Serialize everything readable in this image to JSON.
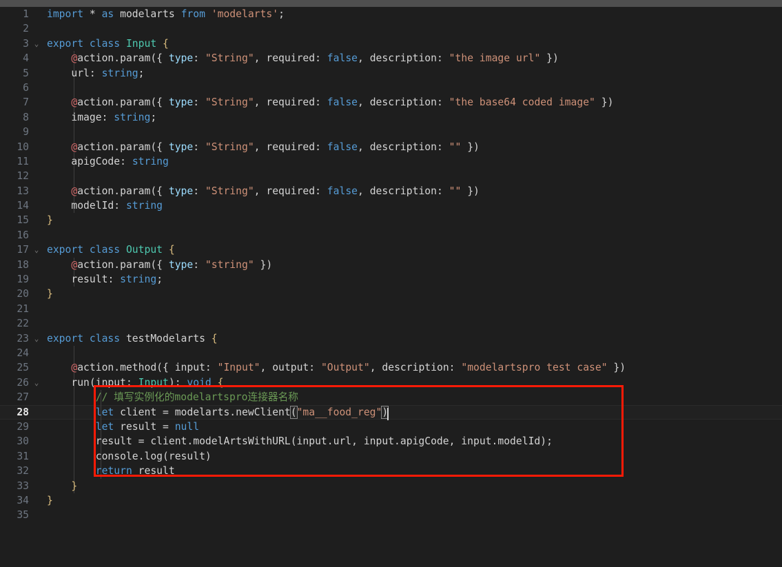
{
  "editor": {
    "title": "code-editor",
    "theme": "dark-plus",
    "background": "#1e1e1e",
    "current_line": 28,
    "cursor_column": 73,
    "total_lines": 35,
    "scrollbar": {
      "orientation": "horizontal",
      "position": "top"
    },
    "annotation": {
      "type": "rectangle",
      "color": "#ff1a06",
      "covers_lines": "27-32"
    },
    "colors": {
      "keyword": "#569cd6",
      "string": "#ce9178",
      "class": "#4ec9b0",
      "comment": "#6a9955",
      "decorator": "#d16969",
      "property": "#9cdcfe",
      "plain": "#d4d4d4",
      "bracket": "#d7ba7d",
      "line_number": "#6e7681",
      "line_number_active": "#e7e7e7"
    }
  },
  "lines": [
    {
      "n": "1",
      "fold": "",
      "guides": 0
    },
    {
      "n": "2",
      "fold": "",
      "guides": 0
    },
    {
      "n": "3",
      "fold": "⌄",
      "guides": 0
    },
    {
      "n": "4",
      "fold": "",
      "guides": 1
    },
    {
      "n": "5",
      "fold": "",
      "guides": 1
    },
    {
      "n": "6",
      "fold": "",
      "guides": 1
    },
    {
      "n": "7",
      "fold": "",
      "guides": 1
    },
    {
      "n": "8",
      "fold": "",
      "guides": 1
    },
    {
      "n": "9",
      "fold": "",
      "guides": 1
    },
    {
      "n": "10",
      "fold": "",
      "guides": 1
    },
    {
      "n": "11",
      "fold": "",
      "guides": 1
    },
    {
      "n": "12",
      "fold": "",
      "guides": 1
    },
    {
      "n": "13",
      "fold": "",
      "guides": 1
    },
    {
      "n": "14",
      "fold": "",
      "guides": 1
    },
    {
      "n": "15",
      "fold": "",
      "guides": 0
    },
    {
      "n": "16",
      "fold": "",
      "guides": 0
    },
    {
      "n": "17",
      "fold": "⌄",
      "guides": 0
    },
    {
      "n": "18",
      "fold": "",
      "guides": 1
    },
    {
      "n": "19",
      "fold": "",
      "guides": 1
    },
    {
      "n": "20",
      "fold": "",
      "guides": 0
    },
    {
      "n": "21",
      "fold": "",
      "guides": 0
    },
    {
      "n": "22",
      "fold": "",
      "guides": 0
    },
    {
      "n": "23",
      "fold": "⌄",
      "guides": 0
    },
    {
      "n": "24",
      "fold": "",
      "guides": 1
    },
    {
      "n": "25",
      "fold": "",
      "guides": 1
    },
    {
      "n": "26",
      "fold": "⌄",
      "guides": 1
    },
    {
      "n": "27",
      "fold": "",
      "guides": 2
    },
    {
      "n": "28",
      "fold": "",
      "guides": 2
    },
    {
      "n": "29",
      "fold": "",
      "guides": 2
    },
    {
      "n": "30",
      "fold": "",
      "guides": 2
    },
    {
      "n": "31",
      "fold": "",
      "guides": 2
    },
    {
      "n": "32",
      "fold": "",
      "guides": 2
    },
    {
      "n": "33",
      "fold": "",
      "guides": 1
    },
    {
      "n": "34",
      "fold": "",
      "guides": 0
    },
    {
      "n": "35",
      "fold": "",
      "guides": 0
    }
  ],
  "code": {
    "l1": "import * as modelarts from 'modelarts';",
    "l2": "",
    "l3": "export class Input {",
    "l4": "    @action.param({ type: \"String\", required: false, description: \"the image url\" })",
    "l5": "    url: string;",
    "l6": "",
    "l7": "    @action.param({ type: \"String\", required: false, description: \"the base64 coded image\" })",
    "l8": "    image: string;",
    "l9": "",
    "l10": "    @action.param({ type: \"String\", required: false, description: \"\" })",
    "l11": "    apigCode: string",
    "l12": "",
    "l13": "    @action.param({ type: \"String\", required: false, description: \"\" })",
    "l14": "    modelId: string",
    "l15": "}",
    "l16": "",
    "l17": "export class Output {",
    "l18": "    @action.param({ type: \"string\" })",
    "l19": "    result: string;",
    "l20": "}",
    "l21": "",
    "l22": "",
    "l23": "export class testModelarts {",
    "l24": "",
    "l25": "    @action.method({ input: \"Input\", output: \"Output\", description: \"modelartspro test case\" })",
    "l26": "    run(input: Input): void {",
    "l27": "        // 填写实例化的modelartspro连接器名称",
    "l28": "        let client = modelarts.newClient(\"ma__food_reg\")",
    "l29": "        let result = null",
    "l30": "        result = client.modelArtsWithURL(input.url, input.apigCode, input.modelId);",
    "l31": "        console.log(result)",
    "l32": "        return result",
    "l33": "    }",
    "l34": "}",
    "l35": ""
  },
  "tokens": {
    "kw_import": "import",
    "star": " * ",
    "kw_as": "as",
    "id_modelarts": " modelarts ",
    "kw_from": "from",
    "str_modelarts": " 'modelarts'",
    "semi": ";",
    "kw_export": "export",
    "kw_class": "class",
    "cls_Input": "Input",
    "cls_Output": "Output",
    "id_testModelarts": "testModelarts",
    "brace_open": "{",
    "brace_close": "}",
    "at": "@",
    "action_param": "action.param({ ",
    "action_method": "action.method({ ",
    "prop_type": "type",
    "prop_input": "input",
    "prop_output": "output",
    "prop_required": "required",
    "prop_description": "description",
    "colon": ": ",
    "comma": ", ",
    "str_String": "\"String\"",
    "str_string_lc": "\"string\"",
    "kw_false": "false",
    "str_the_image_url": "\"the image url\"",
    "str_the_base64": "\"the base64 coded image\"",
    "str_empty": "\"\"",
    "str_Input": "\"Input\"",
    "str_Output": "\"Output\"",
    "str_modelartspro_test_case": "\"modelartspro test case\"",
    "close_paren_brace": " })",
    "field_url": "    url",
    "field_image": "    image",
    "field_apigCode": "    apigCode",
    "field_modelId": "    modelId",
    "field_result": "    result",
    "type_string": "string",
    "run_sig_a": "    run(input: ",
    "run_sig_b": "): ",
    "kw_void": "void",
    "comment_cn": "// 填写实例化的modelartspro连接器名称",
    "kw_let": "let",
    "let_client": " client = modelarts.newClient",
    "str_ma_food_reg": "\"ma__food_reg\"",
    "paren_open": "(",
    "paren_close": ")",
    "let_result_null": " result = ",
    "kw_null": "null",
    "line30_body": "result = client.modelArtsWithURL(input.url, input.apigCode, input.modelId);",
    "line31_body": "console.log(result)",
    "kw_return": "return",
    "return_result": " result"
  }
}
